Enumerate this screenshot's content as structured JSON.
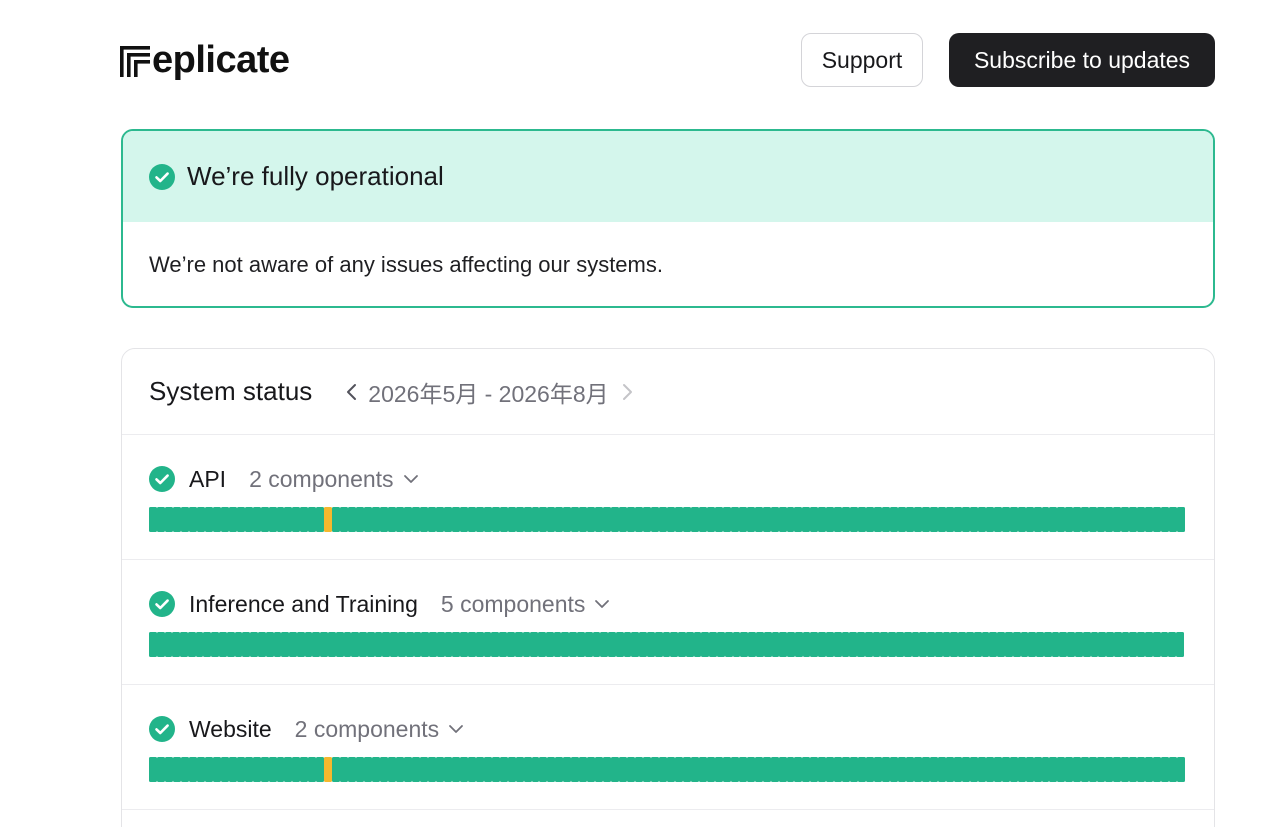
{
  "header": {
    "logo_text": "eplicate",
    "support_label": "Support",
    "subscribe_label": "Subscribe to updates"
  },
  "banner": {
    "title": "We’re fully operational",
    "message": "We’re not aware of any issues affecting our systems.",
    "icon": "check-circle-icon"
  },
  "status": {
    "title": "System status",
    "range_label": "2026年5月 - 2026年8月",
    "prev_icon": "chevron-left-icon",
    "next_icon": "chevron-right-icon",
    "groups": [
      {
        "name": "API",
        "components_label": "2 components",
        "days": "ggggggggggggggggggggggoggggggggggggggggggggggggggggggggggggggggggggggggggggggggggggggggggggggggggggggggggggggggggggggggggggggggggg"
      },
      {
        "name": "Inference and Training",
        "components_label": "5 components",
        "days": "ggggggggggggggggggggggggggggggggggggggggggggggggggggggggggggggggggggggggggggggggggggggggggggggggggggggggggggggggggggggggggggggggggggg"
      },
      {
        "name": "Website",
        "components_label": "2 components",
        "days": "ggggggggggggggggggggggoggggggggggggggggggggggggggggggggggggggggggggggggggggggggggggggggggggggggggggggggggggggggggggggggggggggggggg"
      }
    ],
    "colors": {
      "operational": "#22b48a",
      "degraded": "#f5b82e",
      "outage": "#ef6a4e"
    }
  }
}
